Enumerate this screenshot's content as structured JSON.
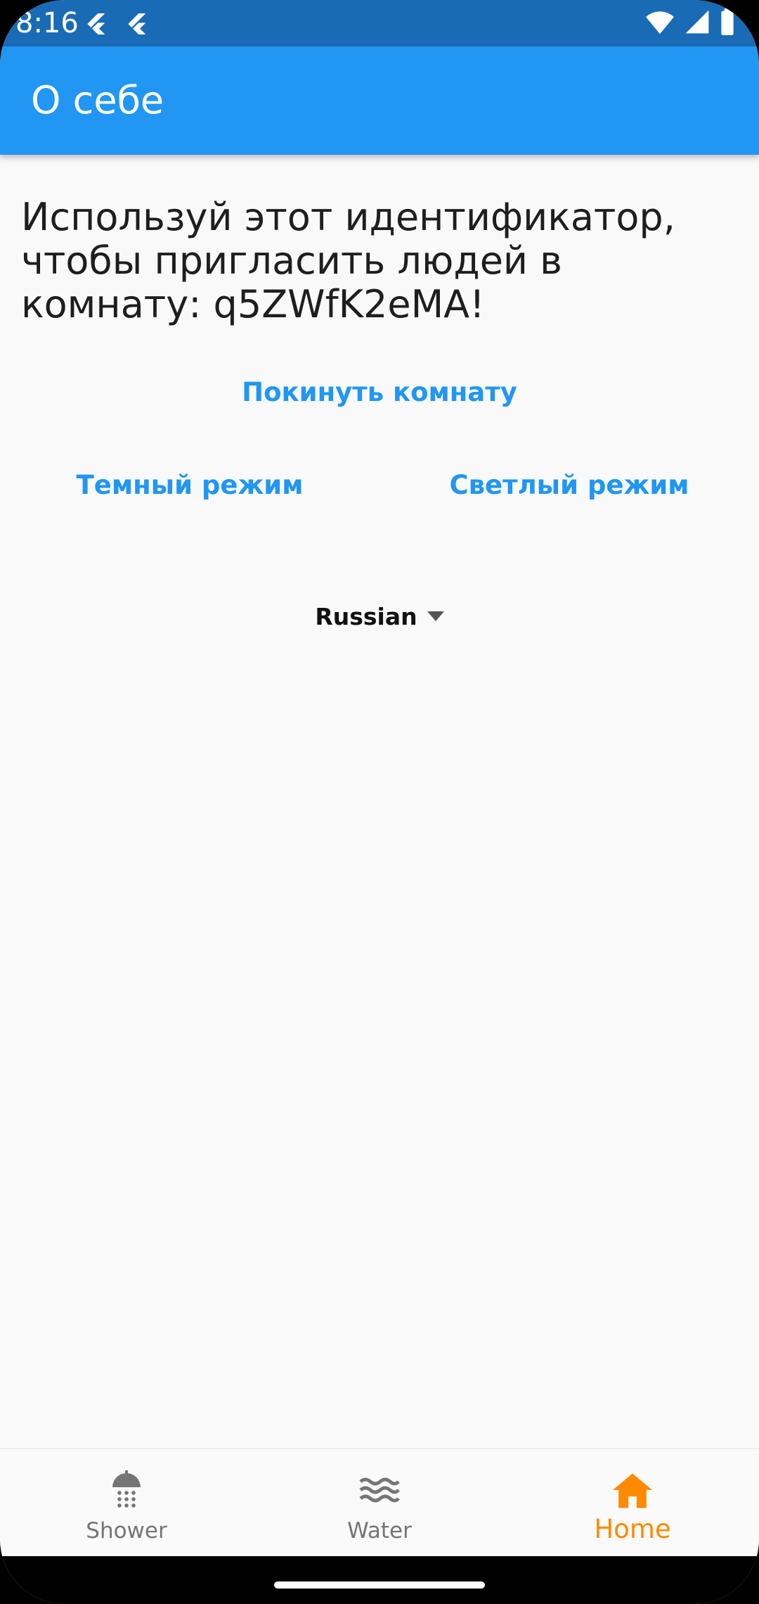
{
  "status_bar": {
    "time": "8:16",
    "icons": [
      "flutter-icon",
      "flutter-icon",
      "wifi-icon",
      "signal-icon",
      "battery-icon"
    ]
  },
  "app_bar": {
    "title": "О себе"
  },
  "content": {
    "invite_message": "Используй этот идентификатор, чтобы пригласить людей в комнату: q5ZWfK2eMA!",
    "leave_room_label": "Покинуть комнату",
    "dark_mode_label": "Темный режим",
    "light_mode_label": "Светлый режим",
    "language_selected": "Russian"
  },
  "bottom_nav": {
    "items": [
      {
        "label": "Shower",
        "icon": "shower-icon",
        "active": false
      },
      {
        "label": "Water",
        "icon": "water-waves-icon",
        "active": false
      },
      {
        "label": "Home",
        "icon": "home-icon",
        "active": true
      }
    ]
  },
  "colors": {
    "status_bar": "#1A6BB5",
    "app_bar": "#2196F3",
    "accent_text": "#2196F3",
    "active_nav": "#FF8A00",
    "inactive_nav": "#757575",
    "background": "#F9F9F9"
  }
}
